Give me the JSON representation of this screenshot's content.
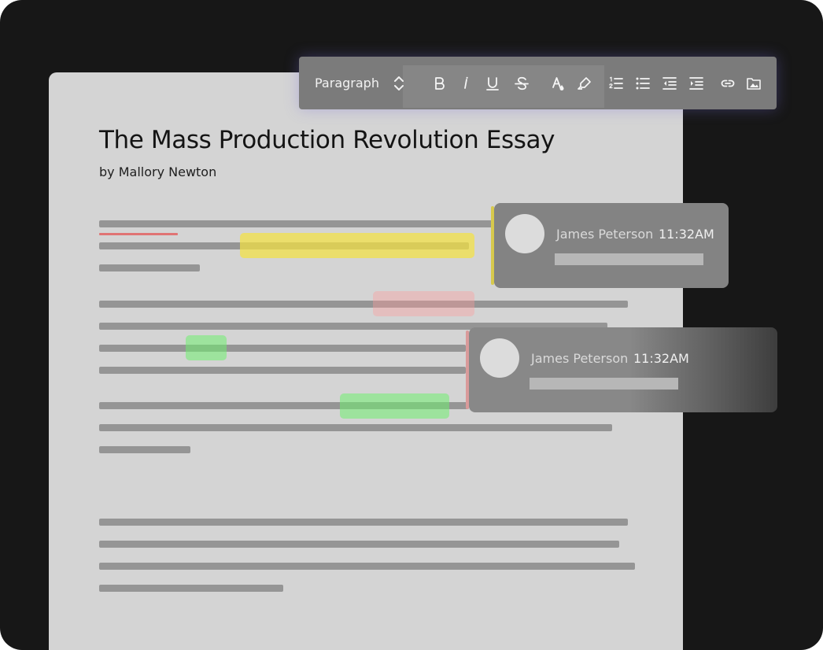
{
  "document": {
    "title": "The Mass Production Revolution Essay",
    "author": "by Mallory Newton"
  },
  "toolbar": {
    "block_format": "Paragraph",
    "buttons": [
      {
        "name": "bold-button",
        "icon": "bold-icon"
      },
      {
        "name": "italic-button",
        "icon": "italic-icon"
      },
      {
        "name": "underline-button",
        "icon": "underline-icon"
      },
      {
        "name": "strikethrough-button",
        "icon": "strikethrough-icon"
      },
      {
        "name": "text-color-button",
        "icon": "text-color-icon"
      },
      {
        "name": "highlight-button",
        "icon": "highlighter-icon"
      },
      {
        "name": "ordered-list-button",
        "icon": "ordered-list-icon"
      },
      {
        "name": "bulleted-list-button",
        "icon": "bulleted-list-icon"
      },
      {
        "name": "outdent-button",
        "icon": "outdent-icon"
      },
      {
        "name": "indent-button",
        "icon": "indent-icon"
      },
      {
        "name": "link-button",
        "icon": "link-icon"
      },
      {
        "name": "insert-image-button",
        "icon": "image-folder-icon"
      }
    ]
  },
  "comments": [
    {
      "author": "James Peterson",
      "time": "11:32AM",
      "accent": "#d7c94c"
    },
    {
      "author": "James Peterson",
      "time": "11:32AM",
      "accent": "#d99a9a"
    }
  ],
  "colors": {
    "frame": "#171717",
    "page": "#d4d4d4",
    "highlight_yellow": "#f4e242",
    "highlight_red": "#ff9b9b",
    "highlight_green": "#70ee70"
  }
}
